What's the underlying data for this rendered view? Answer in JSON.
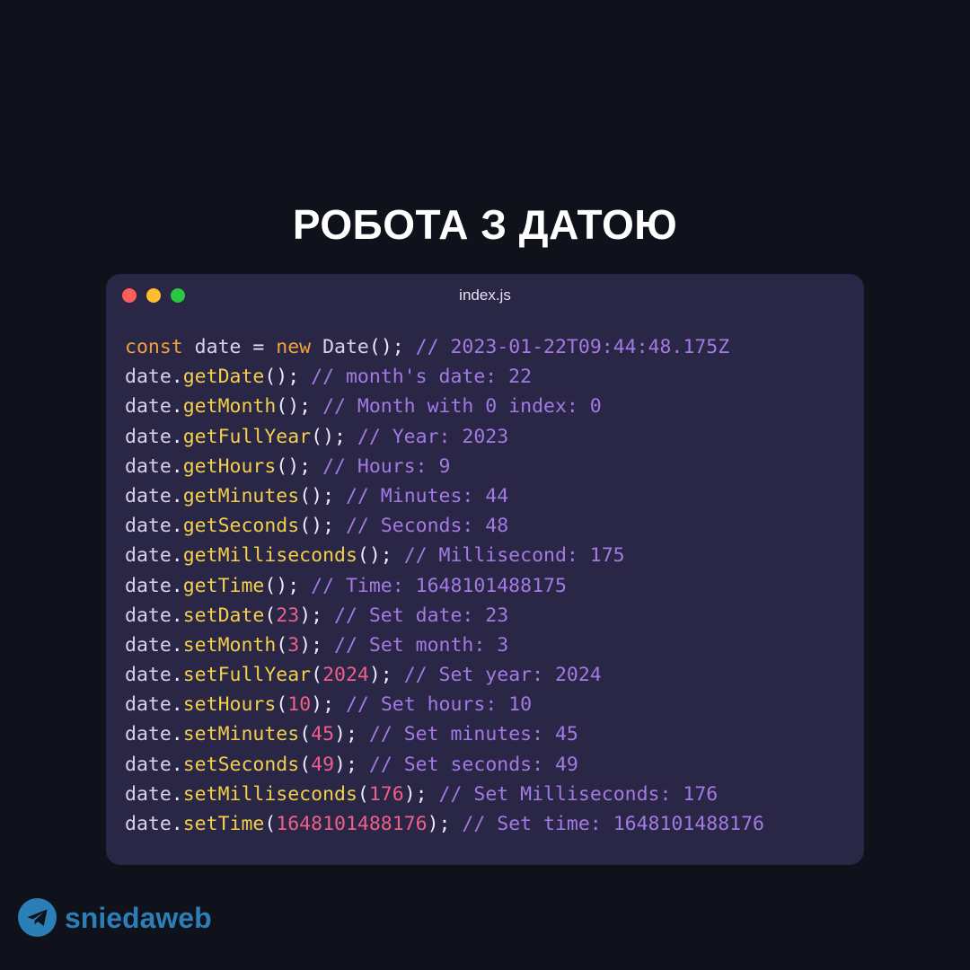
{
  "title": "РОБОТА З ДАТОЮ",
  "editor": {
    "file_name": "index.js",
    "lines": [
      [
        {
          "t": "kw",
          "v": "const"
        },
        {
          "t": "var",
          "v": " date "
        },
        {
          "t": "punc",
          "v": "= "
        },
        {
          "t": "kw",
          "v": "new"
        },
        {
          "t": "class",
          "v": " Date"
        },
        {
          "t": "punc",
          "v": "(); "
        },
        {
          "t": "comment",
          "v": "// 2023-01-22T09:44:48.175Z"
        }
      ],
      [
        {
          "t": "var",
          "v": "date"
        },
        {
          "t": "punc",
          "v": "."
        },
        {
          "t": "method",
          "v": "getDate"
        },
        {
          "t": "punc",
          "v": "(); "
        },
        {
          "t": "comment",
          "v": "// month's date: 22"
        }
      ],
      [
        {
          "t": "var",
          "v": "date"
        },
        {
          "t": "punc",
          "v": "."
        },
        {
          "t": "method",
          "v": "getMonth"
        },
        {
          "t": "punc",
          "v": "(); "
        },
        {
          "t": "comment",
          "v": "// Month with 0 index: 0"
        }
      ],
      [
        {
          "t": "var",
          "v": "date"
        },
        {
          "t": "punc",
          "v": "."
        },
        {
          "t": "method",
          "v": "getFullYear"
        },
        {
          "t": "punc",
          "v": "(); "
        },
        {
          "t": "comment",
          "v": "// Year: 2023"
        }
      ],
      [
        {
          "t": "var",
          "v": "date"
        },
        {
          "t": "punc",
          "v": "."
        },
        {
          "t": "method",
          "v": "getHours"
        },
        {
          "t": "punc",
          "v": "(); "
        },
        {
          "t": "comment",
          "v": "// Hours: 9"
        }
      ],
      [
        {
          "t": "var",
          "v": "date"
        },
        {
          "t": "punc",
          "v": "."
        },
        {
          "t": "method",
          "v": "getMinutes"
        },
        {
          "t": "punc",
          "v": "(); "
        },
        {
          "t": "comment",
          "v": "// Minutes: 44"
        }
      ],
      [
        {
          "t": "var",
          "v": "date"
        },
        {
          "t": "punc",
          "v": "."
        },
        {
          "t": "method",
          "v": "getSeconds"
        },
        {
          "t": "punc",
          "v": "(); "
        },
        {
          "t": "comment",
          "v": "// Seconds: 48"
        }
      ],
      [
        {
          "t": "var",
          "v": "date"
        },
        {
          "t": "punc",
          "v": "."
        },
        {
          "t": "method",
          "v": "getMilliseconds"
        },
        {
          "t": "punc",
          "v": "(); "
        },
        {
          "t": "comment",
          "v": "// Millisecond: 175"
        }
      ],
      [
        {
          "t": "var",
          "v": "date"
        },
        {
          "t": "punc",
          "v": "."
        },
        {
          "t": "method",
          "v": "getTime"
        },
        {
          "t": "punc",
          "v": "(); "
        },
        {
          "t": "comment",
          "v": "// Time: 1648101488175"
        }
      ],
      [
        {
          "t": "var",
          "v": "date"
        },
        {
          "t": "punc",
          "v": "."
        },
        {
          "t": "method",
          "v": "setDate"
        },
        {
          "t": "punc",
          "v": "("
        },
        {
          "t": "num",
          "v": "23"
        },
        {
          "t": "punc",
          "v": "); "
        },
        {
          "t": "comment",
          "v": "// Set date: 23"
        }
      ],
      [
        {
          "t": "var",
          "v": "date"
        },
        {
          "t": "punc",
          "v": "."
        },
        {
          "t": "method",
          "v": "setMonth"
        },
        {
          "t": "punc",
          "v": "("
        },
        {
          "t": "num",
          "v": "3"
        },
        {
          "t": "punc",
          "v": "); "
        },
        {
          "t": "comment",
          "v": "// Set month: 3"
        }
      ],
      [
        {
          "t": "var",
          "v": "date"
        },
        {
          "t": "punc",
          "v": "."
        },
        {
          "t": "method",
          "v": "setFullYear"
        },
        {
          "t": "punc",
          "v": "("
        },
        {
          "t": "num",
          "v": "2024"
        },
        {
          "t": "punc",
          "v": "); "
        },
        {
          "t": "comment",
          "v": "// Set year: 2024"
        }
      ],
      [
        {
          "t": "var",
          "v": "date"
        },
        {
          "t": "punc",
          "v": "."
        },
        {
          "t": "method",
          "v": "setHours"
        },
        {
          "t": "punc",
          "v": "("
        },
        {
          "t": "num",
          "v": "10"
        },
        {
          "t": "punc",
          "v": "); "
        },
        {
          "t": "comment",
          "v": "// Set hours: 10"
        }
      ],
      [
        {
          "t": "var",
          "v": "date"
        },
        {
          "t": "punc",
          "v": "."
        },
        {
          "t": "method",
          "v": "setMinutes"
        },
        {
          "t": "punc",
          "v": "("
        },
        {
          "t": "num",
          "v": "45"
        },
        {
          "t": "punc",
          "v": "); "
        },
        {
          "t": "comment",
          "v": "// Set minutes: 45"
        }
      ],
      [
        {
          "t": "var",
          "v": "date"
        },
        {
          "t": "punc",
          "v": "."
        },
        {
          "t": "method",
          "v": "setSeconds"
        },
        {
          "t": "punc",
          "v": "("
        },
        {
          "t": "num",
          "v": "49"
        },
        {
          "t": "punc",
          "v": "); "
        },
        {
          "t": "comment",
          "v": "// Set seconds: 49"
        }
      ],
      [
        {
          "t": "var",
          "v": "date"
        },
        {
          "t": "punc",
          "v": "."
        },
        {
          "t": "method",
          "v": "setMilliseconds"
        },
        {
          "t": "punc",
          "v": "("
        },
        {
          "t": "num",
          "v": "176"
        },
        {
          "t": "punc",
          "v": "); "
        },
        {
          "t": "comment",
          "v": "// Set Milliseconds: 176"
        }
      ],
      [
        {
          "t": "var",
          "v": "date"
        },
        {
          "t": "punc",
          "v": "."
        },
        {
          "t": "method",
          "v": "setTime"
        },
        {
          "t": "punc",
          "v": "("
        },
        {
          "t": "num",
          "v": "1648101488176"
        },
        {
          "t": "punc",
          "v": "); "
        },
        {
          "t": "comment",
          "v": "// Set time: 1648101488176"
        }
      ]
    ]
  },
  "brand": {
    "name": "sniedaweb",
    "icon": "telegram-icon"
  },
  "colors": {
    "background": "#0f121b",
    "window": "#2a2646",
    "keyword": "#f0a23c",
    "method": "#f3cf4c",
    "number": "#ef5f8a",
    "comment": "#a37ae4",
    "brand": "#2c7eb6"
  }
}
